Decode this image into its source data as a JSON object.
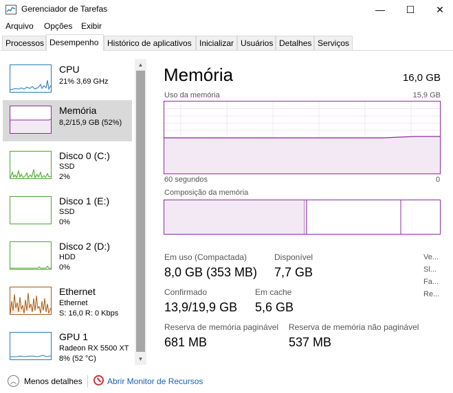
{
  "window": {
    "title": "Gerenciador de Tarefas",
    "minimize": "—",
    "maximize": "☐",
    "close": "✕"
  },
  "menu": [
    "Arquivo",
    "Opções",
    "Exibir"
  ],
  "tabs": [
    "Processos",
    "Desempenho",
    "Histórico de aplicativos",
    "Inicializar",
    "Usuários",
    "Detalhes",
    "Serviços"
  ],
  "sidebar": [
    {
      "title": "CPU",
      "sub1": "21%  3,69 GHz",
      "sub2": "",
      "sub3": "",
      "color": "#1e7ab8"
    },
    {
      "title": "Memória",
      "sub1": "8,2/15,9 GB (52%)",
      "sub2": "",
      "sub3": "",
      "color": "#8b2a9c"
    },
    {
      "title": "Disco 0 (C:)",
      "sub1": "SSD",
      "sub2": "2%",
      "sub3": "",
      "color": "#4ca32c"
    },
    {
      "title": "Disco 1 (E:)",
      "sub1": "SSD",
      "sub2": "0%",
      "sub3": "",
      "color": "#4ca32c"
    },
    {
      "title": "Disco 2 (D:)",
      "sub1": "HDD",
      "sub2": "0%",
      "sub3": "",
      "color": "#4ca32c"
    },
    {
      "title": "Ethernet",
      "sub1": "Ethernet",
      "sub2": "S: 16,0  R: 0 Kbps",
      "sub3": "",
      "color": "#a7590f"
    },
    {
      "title": "GPU 1",
      "sub1": "Radeon RX 5500 XT",
      "sub2": "8%  (52 °C)",
      "sub3": "",
      "color": "#1e7ab8"
    }
  ],
  "main": {
    "title": "Memória",
    "total": "16,0 GB",
    "usage_label": "Uso da memória",
    "usage_max": "15,9 GB",
    "time_left": "60 segundos",
    "time_right": "0",
    "composition_label": "Composição da memória"
  },
  "stats": {
    "in_use_label": "Em uso (Compactada)",
    "in_use_value": "8,0 GB (353 MB)",
    "available_label": "Disponível",
    "available_value": "7,7 GB",
    "committed_label": "Confirmado",
    "committed_value": "13,9/19,9 GB",
    "cached_label": "Em cache",
    "cached_value": "5,6 GB",
    "paged_label": "Reserva de memória paginável",
    "paged_value": "681 MB",
    "nonpaged_label": "Reserva de memória não paginável",
    "nonpaged_value": "537 MB",
    "trunc": [
      "Ve...",
      "Sl...",
      "Fa...",
      "Re..."
    ]
  },
  "footer": {
    "less_details": "Menos detalhes",
    "resource_monitor": "Abrir Monitor de Recursos"
  },
  "colors": {
    "memory": "#8b2a9c",
    "cpu": "#1e7ab8",
    "disk": "#4ca32c",
    "ethernet": "#a7590f"
  }
}
